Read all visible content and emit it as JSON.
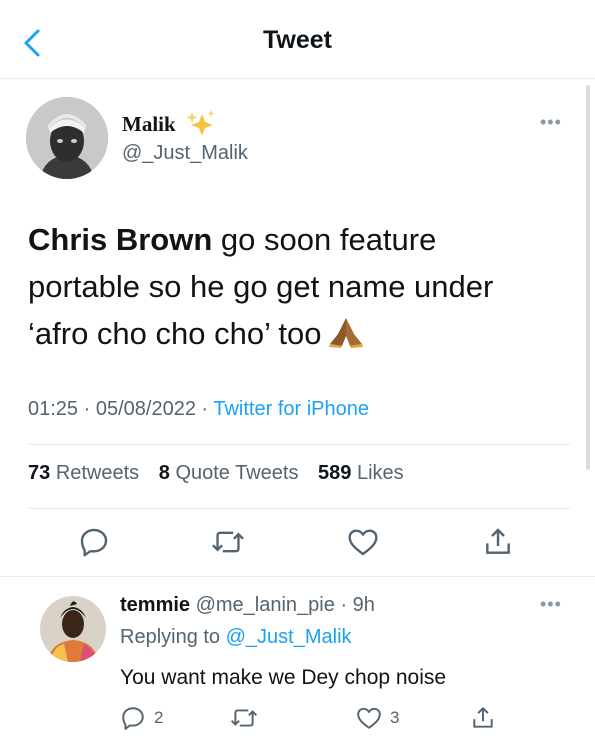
{
  "header": {
    "title": "Tweet",
    "back_icon": "chevron-left-icon"
  },
  "tweet": {
    "author_name": "Malik",
    "author_emoji": "sparkles-icon",
    "author_handle": "@_Just_Malik",
    "text_bold": "Chris Brown",
    "text_line1_rest": " go soon feature",
    "text_line2": "portable so he go get name under",
    "text_line3": "‘afro cho cho cho’ too",
    "text_emoji": "folded-hands-icon",
    "time": "01:25",
    "date": "05/08/2022",
    "source": "Twitter for iPhone",
    "retweets_count": "73",
    "retweets_label": "Retweets",
    "quotes_count": "8",
    "quotes_label": "Quote Tweets",
    "likes_count": "589",
    "likes_label": "Likes"
  },
  "reply": {
    "name": "temmie",
    "handle": "@me_lanin_pie",
    "time": "9h",
    "replying_prefix": "Replying to",
    "replying_handle": "@_Just_Malik",
    "text": "You want make we Dey chop noise",
    "reply_count": "2",
    "like_count": "3"
  },
  "colors": {
    "accent": "#1da1f2",
    "secondary_text": "#536471",
    "divider": "#e6ecf0"
  }
}
